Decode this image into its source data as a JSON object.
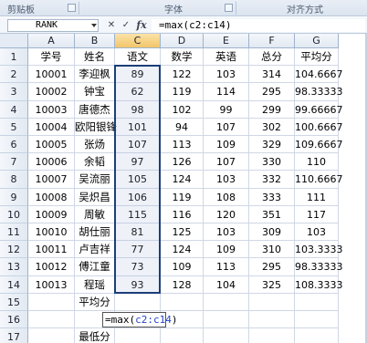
{
  "ribbon": {
    "groups": [
      "剪贴板",
      "字体",
      "对齐方式"
    ]
  },
  "formula_bar": {
    "name_box": "RANK",
    "cancel_symbol": "✕",
    "enter_symbol": "✓",
    "fx_label": "fx",
    "formula": "=max(c2:c14)"
  },
  "columns": [
    "A",
    "B",
    "C",
    "D",
    "E",
    "F",
    "G"
  ],
  "rows": [
    "1",
    "2",
    "3",
    "4",
    "5",
    "6",
    "7",
    "8",
    "9",
    "10",
    "11",
    "12",
    "13",
    "14",
    "15",
    "16",
    "17"
  ],
  "table": {
    "headers": [
      "学号",
      "姓名",
      "语文",
      "数学",
      "英语",
      "总分",
      "平均分"
    ],
    "records": [
      [
        "10001",
        "李迎枫",
        "89",
        "122",
        "103",
        "314",
        "104.6667"
      ],
      [
        "10002",
        "钟宝",
        "62",
        "119",
        "114",
        "295",
        "98.33333"
      ],
      [
        "10003",
        "唐德杰",
        "98",
        "102",
        "99",
        "299",
        "99.66667"
      ],
      [
        "10004",
        "欧阳银锋",
        "101",
        "94",
        "107",
        "302",
        "100.6667"
      ],
      [
        "10005",
        "张炀",
        "107",
        "113",
        "109",
        "329",
        "109.6667"
      ],
      [
        "10006",
        "余韬",
        "97",
        "126",
        "107",
        "330",
        "110"
      ],
      [
        "10007",
        "吴流丽",
        "105",
        "124",
        "103",
        "332",
        "110.6667"
      ],
      [
        "10008",
        "吴炽昌",
        "106",
        "119",
        "108",
        "333",
        "111"
      ],
      [
        "10009",
        "周敏",
        "115",
        "116",
        "120",
        "351",
        "117"
      ],
      [
        "10010",
        "胡仕丽",
        "81",
        "125",
        "103",
        "309",
        "103"
      ],
      [
        "10011",
        "卢吉祥",
        "77",
        "124",
        "109",
        "310",
        "103.3333"
      ],
      [
        "10012",
        "傅江童",
        "73",
        "109",
        "113",
        "295",
        "98.33333"
      ],
      [
        "10013",
        "程瑶",
        "93",
        "128",
        "104",
        "325",
        "108.3333"
      ]
    ],
    "row15_label": "平均分",
    "row17_label": "最低分",
    "editing_cell": {
      "prefix": "=max(",
      "ref": "c2:c14",
      "suffix": ")"
    }
  },
  "colors": {
    "selection_border": "#1b3f7a",
    "reference_blue": "#2646c7",
    "header_highlight": "#f2c66a"
  }
}
